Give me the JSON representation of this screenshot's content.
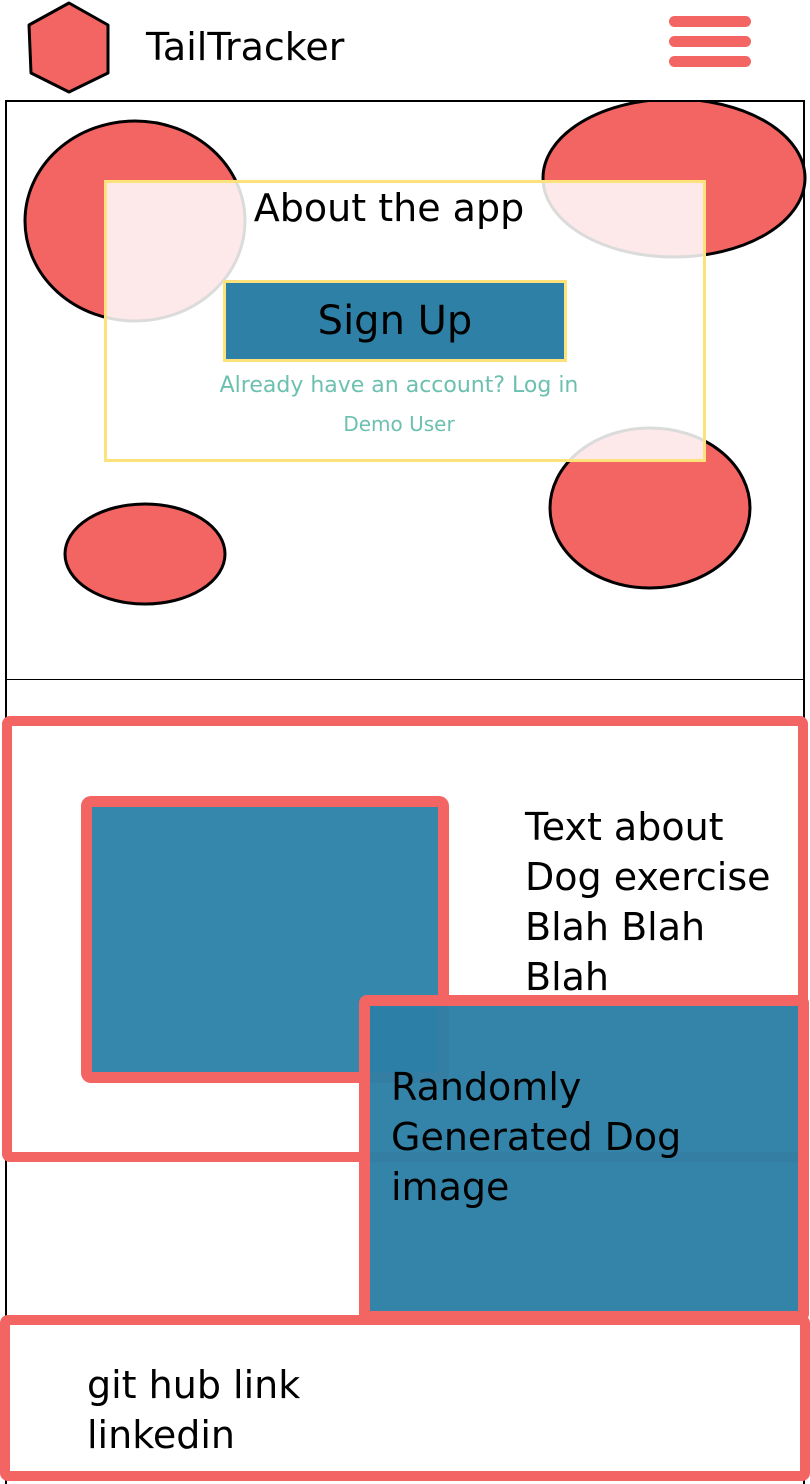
{
  "header": {
    "logo_icon": "hexagon-logo-icon",
    "title": "TailTracker",
    "menu_icon": "hamburger-menu-icon"
  },
  "hero": {
    "about_title": "About the app",
    "signup_label": "Sign Up",
    "login_link": "Already have an account? Log in",
    "demo_link": "Demo User"
  },
  "content": {
    "exercise_text": [
      "Text about",
      "Dog exercise",
      "Blah Blah",
      "Blah"
    ],
    "dog_image_text": [
      "Randomly",
      "Generated Dog",
      "image"
    ]
  },
  "footer": {
    "github_link": "git hub link",
    "linkedin_link": "linkedin"
  },
  "colors": {
    "accent_red": "#f26563",
    "primary_blue": "#2e80a6",
    "highlight_yellow": "#fde17a",
    "link_teal": "#6cc0b0"
  }
}
